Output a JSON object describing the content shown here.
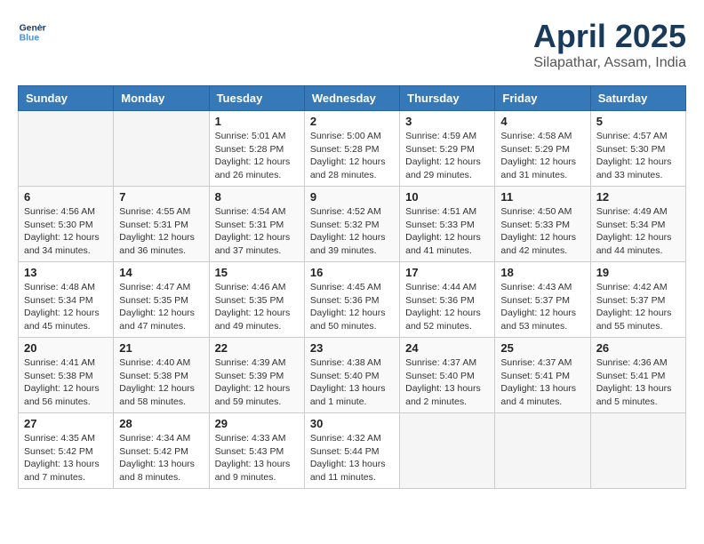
{
  "logo": {
    "line1": "General",
    "line2": "Blue"
  },
  "title": "April 2025",
  "subtitle": "Silapathar, Assam, India",
  "weekdays": [
    "Sunday",
    "Monday",
    "Tuesday",
    "Wednesday",
    "Thursday",
    "Friday",
    "Saturday"
  ],
  "weeks": [
    [
      null,
      null,
      {
        "day": 1,
        "sunrise": "5:01 AM",
        "sunset": "5:28 PM",
        "daylight": "12 hours and 26 minutes."
      },
      {
        "day": 2,
        "sunrise": "5:00 AM",
        "sunset": "5:28 PM",
        "daylight": "12 hours and 28 minutes."
      },
      {
        "day": 3,
        "sunrise": "4:59 AM",
        "sunset": "5:29 PM",
        "daylight": "12 hours and 29 minutes."
      },
      {
        "day": 4,
        "sunrise": "4:58 AM",
        "sunset": "5:29 PM",
        "daylight": "12 hours and 31 minutes."
      },
      {
        "day": 5,
        "sunrise": "4:57 AM",
        "sunset": "5:30 PM",
        "daylight": "12 hours and 33 minutes."
      }
    ],
    [
      {
        "day": 6,
        "sunrise": "4:56 AM",
        "sunset": "5:30 PM",
        "daylight": "12 hours and 34 minutes."
      },
      {
        "day": 7,
        "sunrise": "4:55 AM",
        "sunset": "5:31 PM",
        "daylight": "12 hours and 36 minutes."
      },
      {
        "day": 8,
        "sunrise": "4:54 AM",
        "sunset": "5:31 PM",
        "daylight": "12 hours and 37 minutes."
      },
      {
        "day": 9,
        "sunrise": "4:52 AM",
        "sunset": "5:32 PM",
        "daylight": "12 hours and 39 minutes."
      },
      {
        "day": 10,
        "sunrise": "4:51 AM",
        "sunset": "5:33 PM",
        "daylight": "12 hours and 41 minutes."
      },
      {
        "day": 11,
        "sunrise": "4:50 AM",
        "sunset": "5:33 PM",
        "daylight": "12 hours and 42 minutes."
      },
      {
        "day": 12,
        "sunrise": "4:49 AM",
        "sunset": "5:34 PM",
        "daylight": "12 hours and 44 minutes."
      }
    ],
    [
      {
        "day": 13,
        "sunrise": "4:48 AM",
        "sunset": "5:34 PM",
        "daylight": "12 hours and 45 minutes."
      },
      {
        "day": 14,
        "sunrise": "4:47 AM",
        "sunset": "5:35 PM",
        "daylight": "12 hours and 47 minutes."
      },
      {
        "day": 15,
        "sunrise": "4:46 AM",
        "sunset": "5:35 PM",
        "daylight": "12 hours and 49 minutes."
      },
      {
        "day": 16,
        "sunrise": "4:45 AM",
        "sunset": "5:36 PM",
        "daylight": "12 hours and 50 minutes."
      },
      {
        "day": 17,
        "sunrise": "4:44 AM",
        "sunset": "5:36 PM",
        "daylight": "12 hours and 52 minutes."
      },
      {
        "day": 18,
        "sunrise": "4:43 AM",
        "sunset": "5:37 PM",
        "daylight": "12 hours and 53 minutes."
      },
      {
        "day": 19,
        "sunrise": "4:42 AM",
        "sunset": "5:37 PM",
        "daylight": "12 hours and 55 minutes."
      }
    ],
    [
      {
        "day": 20,
        "sunrise": "4:41 AM",
        "sunset": "5:38 PM",
        "daylight": "12 hours and 56 minutes."
      },
      {
        "day": 21,
        "sunrise": "4:40 AM",
        "sunset": "5:38 PM",
        "daylight": "12 hours and 58 minutes."
      },
      {
        "day": 22,
        "sunrise": "4:39 AM",
        "sunset": "5:39 PM",
        "daylight": "12 hours and 59 minutes."
      },
      {
        "day": 23,
        "sunrise": "4:38 AM",
        "sunset": "5:40 PM",
        "daylight": "13 hours and 1 minute."
      },
      {
        "day": 24,
        "sunrise": "4:37 AM",
        "sunset": "5:40 PM",
        "daylight": "13 hours and 2 minutes."
      },
      {
        "day": 25,
        "sunrise": "4:37 AM",
        "sunset": "5:41 PM",
        "daylight": "13 hours and 4 minutes."
      },
      {
        "day": 26,
        "sunrise": "4:36 AM",
        "sunset": "5:41 PM",
        "daylight": "13 hours and 5 minutes."
      }
    ],
    [
      {
        "day": 27,
        "sunrise": "4:35 AM",
        "sunset": "5:42 PM",
        "daylight": "13 hours and 7 minutes."
      },
      {
        "day": 28,
        "sunrise": "4:34 AM",
        "sunset": "5:42 PM",
        "daylight": "13 hours and 8 minutes."
      },
      {
        "day": 29,
        "sunrise": "4:33 AM",
        "sunset": "5:43 PM",
        "daylight": "13 hours and 9 minutes."
      },
      {
        "day": 30,
        "sunrise": "4:32 AM",
        "sunset": "5:44 PM",
        "daylight": "13 hours and 11 minutes."
      },
      null,
      null,
      null
    ]
  ]
}
